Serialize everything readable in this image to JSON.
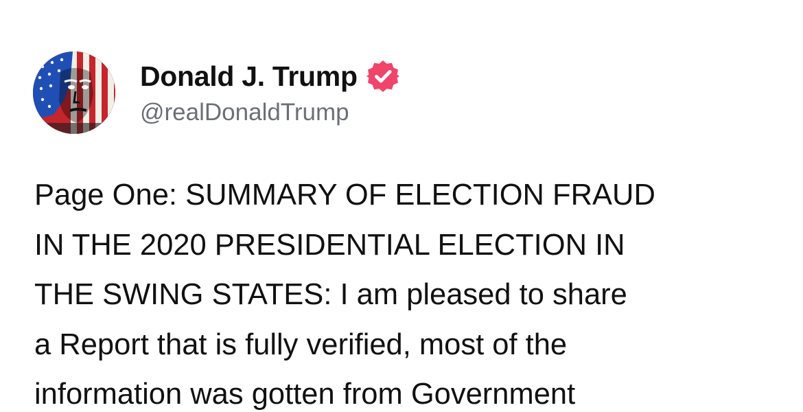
{
  "author": {
    "display_name": "Donald J. Trump",
    "handle": "@realDonaldTrump",
    "verified": true,
    "verified_icon": "verified-badge-icon",
    "verified_color": "#f0446a",
    "avatar_icon": "profile-avatar-image"
  },
  "post": {
    "lines": [
      "Page One: SUMMARY OF ELECTION FRAUD",
      "IN THE 2020 PRESIDENTIAL ELECTION IN",
      "THE SWING STATES: I am pleased to share",
      "a Report that is fully verified, most of the",
      "information was gotten from Government"
    ]
  }
}
